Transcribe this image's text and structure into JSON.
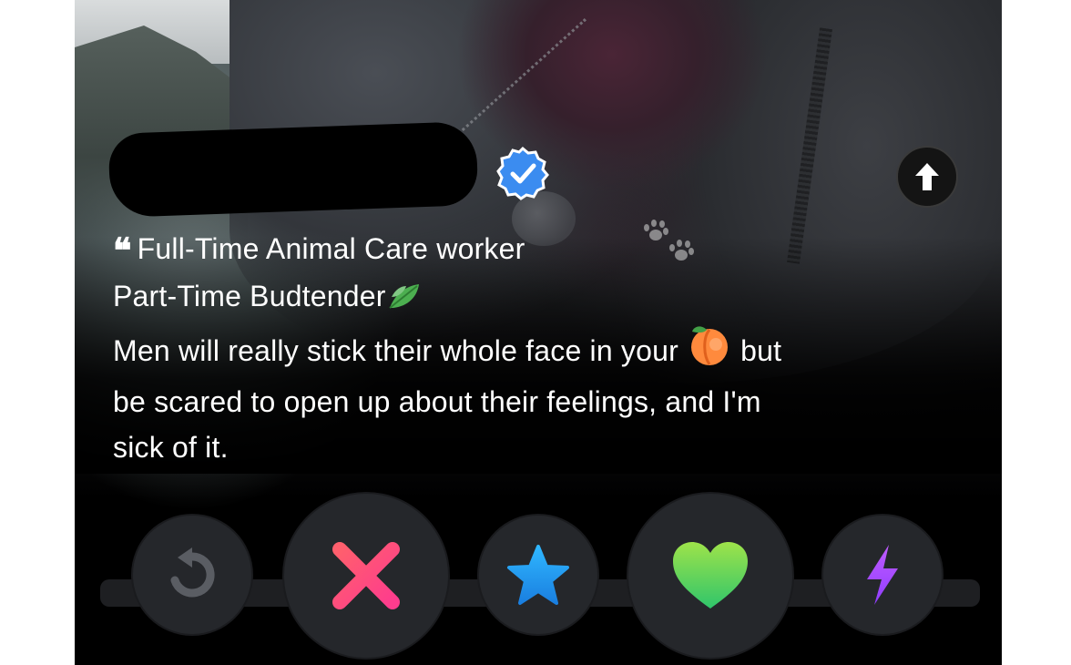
{
  "profile": {
    "verified_icon": "verified-check-icon",
    "info_icon": "arrow-up-icon"
  },
  "bio": {
    "line1": "Full-Time Animal Care worker",
    "line2": "Part-Time Budtender",
    "line3_a": "Men will really stick their whole face in your",
    "line3_b": "but",
    "line4": "be scared to open up about their feelings, and I'm",
    "line5": "sick of it.",
    "quote_icon": "quote-icon",
    "emojis": [
      "paw-prints",
      "leaf",
      "peach"
    ]
  },
  "actions": [
    {
      "name": "rewind",
      "icon": "rewind-icon",
      "color": "#5a5d63"
    },
    {
      "name": "nope",
      "icon": "x-icon",
      "color": "#ff3e7f"
    },
    {
      "name": "super-like",
      "icon": "star-icon",
      "color": "#2aa8f2"
    },
    {
      "name": "like",
      "icon": "heart-icon",
      "color": "#5fd35a"
    },
    {
      "name": "boost",
      "icon": "lightning-icon",
      "color": "#a64dff"
    }
  ],
  "colors": {
    "verified_blue": "#3b8cf0",
    "background": "#000000"
  }
}
